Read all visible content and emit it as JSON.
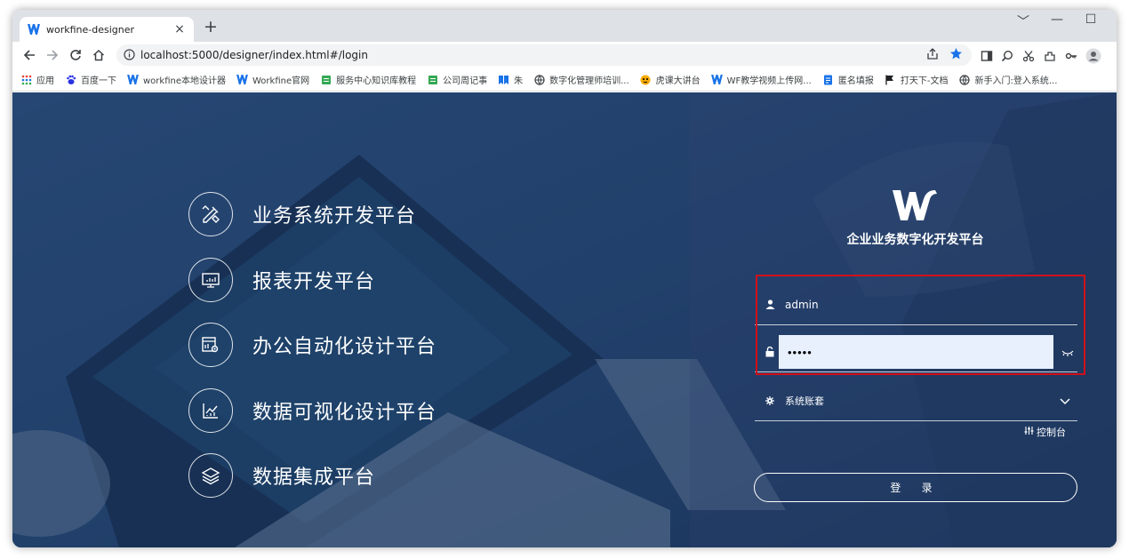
{
  "browser": {
    "tab_title": "workfine-designer",
    "url": "localhost:5000/designer/index.html#/login",
    "new_tab": "+",
    "close_tab": "×",
    "window_controls": [
      "﹀",
      "—",
      "☐"
    ]
  },
  "bookmarks": [
    {
      "label": "应用",
      "icon": "apps-grid-icon"
    },
    {
      "label": "百度一下",
      "icon": "baidu-icon"
    },
    {
      "label": "workfine本地设计器",
      "icon": "workfine-icon"
    },
    {
      "label": "Workfine官网",
      "icon": "workfine-icon"
    },
    {
      "label": "服务中心知识库教程",
      "icon": "green-doc-icon"
    },
    {
      "label": "公司周记事",
      "icon": "green-doc-icon"
    },
    {
      "label": "朱",
      "icon": "blue-ribbon-icon"
    },
    {
      "label": "数字化管理师培训...",
      "icon": "globe-icon"
    },
    {
      "label": "虎课大讲台",
      "icon": "tiger-icon"
    },
    {
      "label": "WF教学视频上传网...",
      "icon": "workfine-icon"
    },
    {
      "label": "匿名填报",
      "icon": "blue-doc-icon"
    },
    {
      "label": "打天下-文档",
      "icon": "flag-icon"
    },
    {
      "label": "新手入门:登入系统...",
      "icon": "globe-icon"
    }
  ],
  "features": [
    {
      "label": "业务系统开发平台",
      "icon": "tools-icon"
    },
    {
      "label": "报表开发平台",
      "icon": "monitor-chart-icon"
    },
    {
      "label": "办公自动化设计平台",
      "icon": "office-gear-icon"
    },
    {
      "label": "数据可视化设计平台",
      "icon": "line-chart-icon"
    },
    {
      "label": "数据集成平台",
      "icon": "layers-icon"
    }
  ],
  "login": {
    "subtitle": "企业业务数字化开发平台",
    "username": "admin",
    "password": "•••••",
    "account_set": "系统账套",
    "console": "控制台",
    "submit": "登 录"
  },
  "colors": {
    "highlight_border": "#d0101b",
    "password_fill": "#e8f0fe"
  }
}
